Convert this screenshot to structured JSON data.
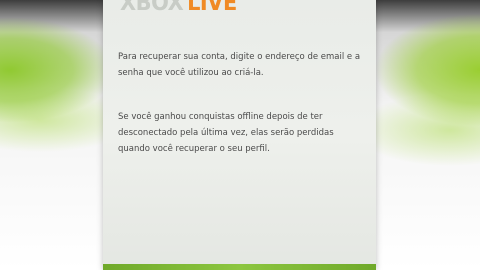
{
  "logo": {
    "xbox": "XBOX",
    "live": "LIVE"
  },
  "dialog": {
    "paragraph1": "Para recuperar sua conta, digite o endereço de email e a senha que você utilizou ao criá-la.",
    "paragraph2": "Se você ganhou conquistas offline depois de ter desconectado pela última vez, elas serão perdidas quando você recuperar o seu perfil."
  },
  "colors": {
    "accent_green": "#8cc63f",
    "live_orange": "#f08a24"
  }
}
